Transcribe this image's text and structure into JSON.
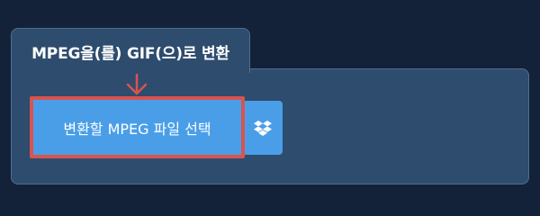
{
  "tab": {
    "title": "MPEG을(를) GIF(으)로 변환"
  },
  "upload": {
    "select_label": "변환할 MPEG 파일 선택",
    "dropbox_icon": "dropbox-icon"
  },
  "colors": {
    "background": "#132238",
    "panel": "#2e4c6e",
    "button": "#4a9ee8",
    "highlight": "#d9534f"
  }
}
